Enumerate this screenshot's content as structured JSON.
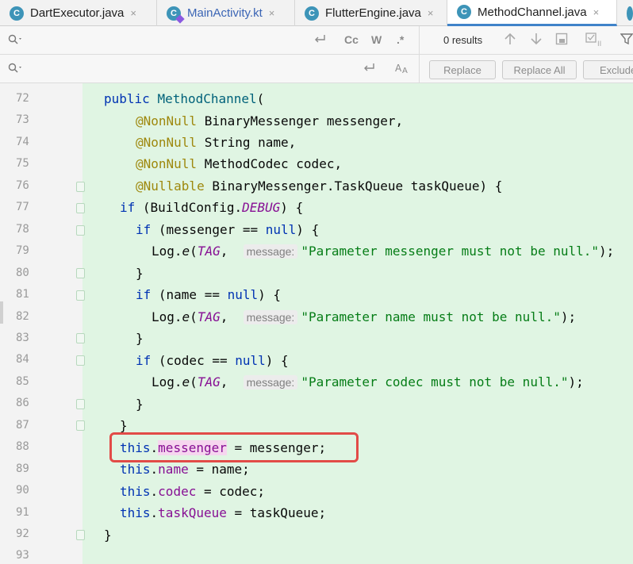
{
  "tabs": [
    {
      "label": "DartExecutor.java",
      "icon": "java-class-icon",
      "icon_letter": "C",
      "active": false
    },
    {
      "label": "MainActivity.kt",
      "icon": "kotlin-class-icon",
      "icon_letter": "C",
      "active": false
    },
    {
      "label": "FlutterEngine.java",
      "icon": "java-class-icon",
      "icon_letter": "C",
      "active": false
    },
    {
      "label": "MethodChannel.java",
      "icon": "java-class-icon",
      "icon_letter": "C",
      "active": true
    }
  ],
  "tab_close_glyph": "×",
  "find": {
    "results_text": "0 results",
    "match_case_label": "Cc",
    "words_label": "W",
    "regex_label": ".*"
  },
  "replace": {
    "replace_label": "Replace",
    "replace_all_label": "Replace All",
    "exclude_label": "Exclude"
  },
  "line_numbers": [
    "72",
    "73",
    "74",
    "75",
    "76",
    "77",
    "78",
    "79",
    "80",
    "81",
    "82",
    "83",
    "84",
    "85",
    "86",
    "87",
    "88",
    "89",
    "90",
    "91",
    "92",
    "93"
  ],
  "code": {
    "l72": {
      "kw": "public",
      "fn": "MethodChannel",
      "rest": "("
    },
    "l73": {
      "ann": "@NonNull",
      "rest": " BinaryMessenger messenger,"
    },
    "l74": {
      "ann": "@NonNull",
      "rest": " String name,"
    },
    "l75": {
      "ann": "@NonNull",
      "rest": " MethodCodec codec,"
    },
    "l76": {
      "ann": "@Nullable",
      "rest": " BinaryMessenger.TaskQueue taskQueue) {"
    },
    "l77": {
      "kw": "if",
      "a": " (BuildConfig.",
      "it": "DEBUG",
      "b": ") {"
    },
    "l78": {
      "kw": "if",
      "a": " (messenger == ",
      "kw2": "null",
      "b": ") {"
    },
    "l79": {
      "a": "Log.",
      "call": "e",
      "b": "(",
      "it": "TAG",
      "c": ",  ",
      "hint": "message:",
      "str": "\"Parameter messenger must not be null.\"",
      "d": ");"
    },
    "l80": {
      "a": "}"
    },
    "l81": {
      "kw": "if",
      "a": " (name == ",
      "kw2": "null",
      "b": ") {"
    },
    "l82": {
      "a": "Log.",
      "call": "e",
      "b": "(",
      "it": "TAG",
      "c": ",  ",
      "hint": "message:",
      "str": "\"Parameter name must not be null.\"",
      "d": ");"
    },
    "l83": {
      "a": "}"
    },
    "l84": {
      "kw": "if",
      "a": " (codec == ",
      "kw2": "null",
      "b": ") {"
    },
    "l85": {
      "a": "Log.",
      "call": "e",
      "b": "(",
      "it": "TAG",
      "c": ",  ",
      "hint": "message:",
      "str": "\"Parameter codec must not be null.\"",
      "d": ");"
    },
    "l86": {
      "a": "}"
    },
    "l87": {
      "a": "}"
    },
    "l88": {
      "kw": "this",
      "dot": ".",
      "fld": "messenger",
      "rest": " = messenger;"
    },
    "l89": {
      "kw": "this",
      "dot": ".",
      "fld": "name",
      "rest": " = name;"
    },
    "l90": {
      "kw": "this",
      "dot": ".",
      "fld": "codec",
      "rest": " = codec;"
    },
    "l91": {
      "kw": "this",
      "dot": ".",
      "fld": "taskQueue",
      "rest": " = taskQueue;"
    },
    "l92": {
      "a": "}"
    }
  },
  "colors": {
    "editor_bg": "#e0f5e3",
    "keyword": "#0033b3",
    "annotation": "#9e880d",
    "string": "#067d17",
    "field": "#871094",
    "highlight_box": "#e24b47"
  }
}
